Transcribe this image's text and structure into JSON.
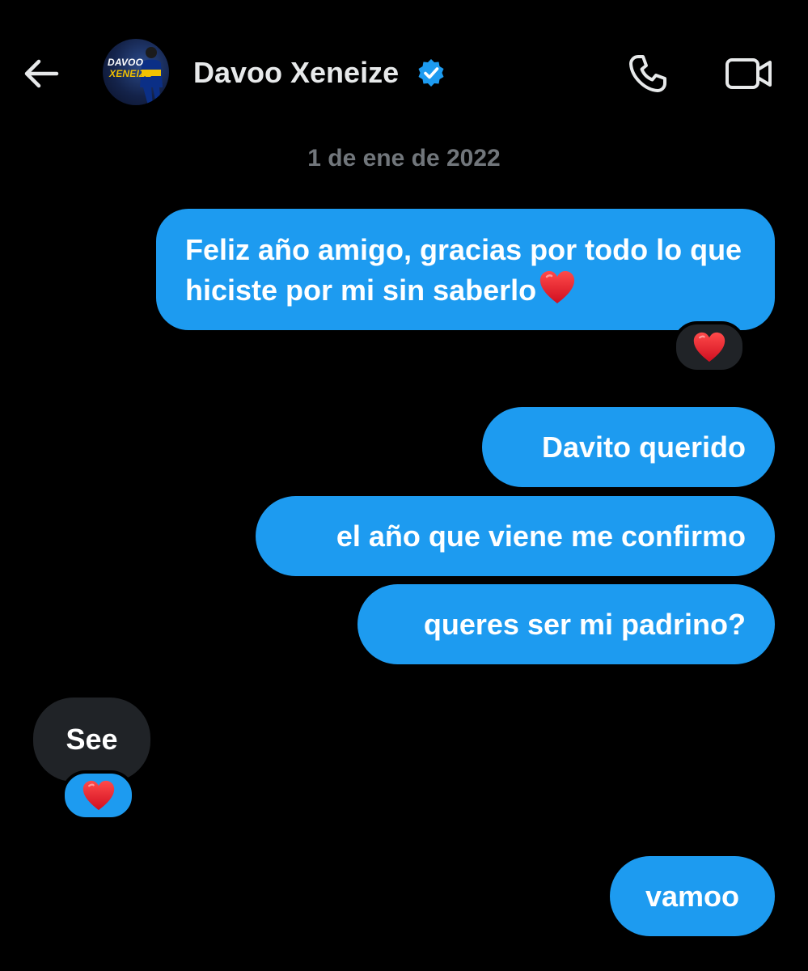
{
  "header": {
    "contact_name": "Davoo Xeneize",
    "avatar_line1": "DAVOO",
    "avatar_line2": "XENEIZE",
    "verified": true,
    "icons": {
      "back": "arrow-left-icon",
      "call": "phone-icon",
      "video": "video-camera-icon",
      "verified": "verified-badge-icon"
    }
  },
  "conversation": {
    "date_separator": "1 de ene de 2022",
    "messages": [
      {
        "sender": "me",
        "text": "Feliz año amigo, gracias por todo lo que hiciste por mi sin saberlo",
        "trailing_emoji": "heart-icon",
        "reaction": "heart-icon"
      },
      {
        "sender": "me",
        "text": "Davito querido"
      },
      {
        "sender": "me",
        "text": "el año que viene me confirmo"
      },
      {
        "sender": "me",
        "text": "queres ser mi padrino?"
      },
      {
        "sender": "them",
        "text": "See",
        "reaction": "heart-icon"
      },
      {
        "sender": "me",
        "text": "vamoo"
      }
    ]
  },
  "colors": {
    "background": "#000000",
    "sent_bubble": "#1d9bf0",
    "received_bubble": "#202327",
    "muted_text": "#71767b",
    "heart": "#e0162b"
  }
}
